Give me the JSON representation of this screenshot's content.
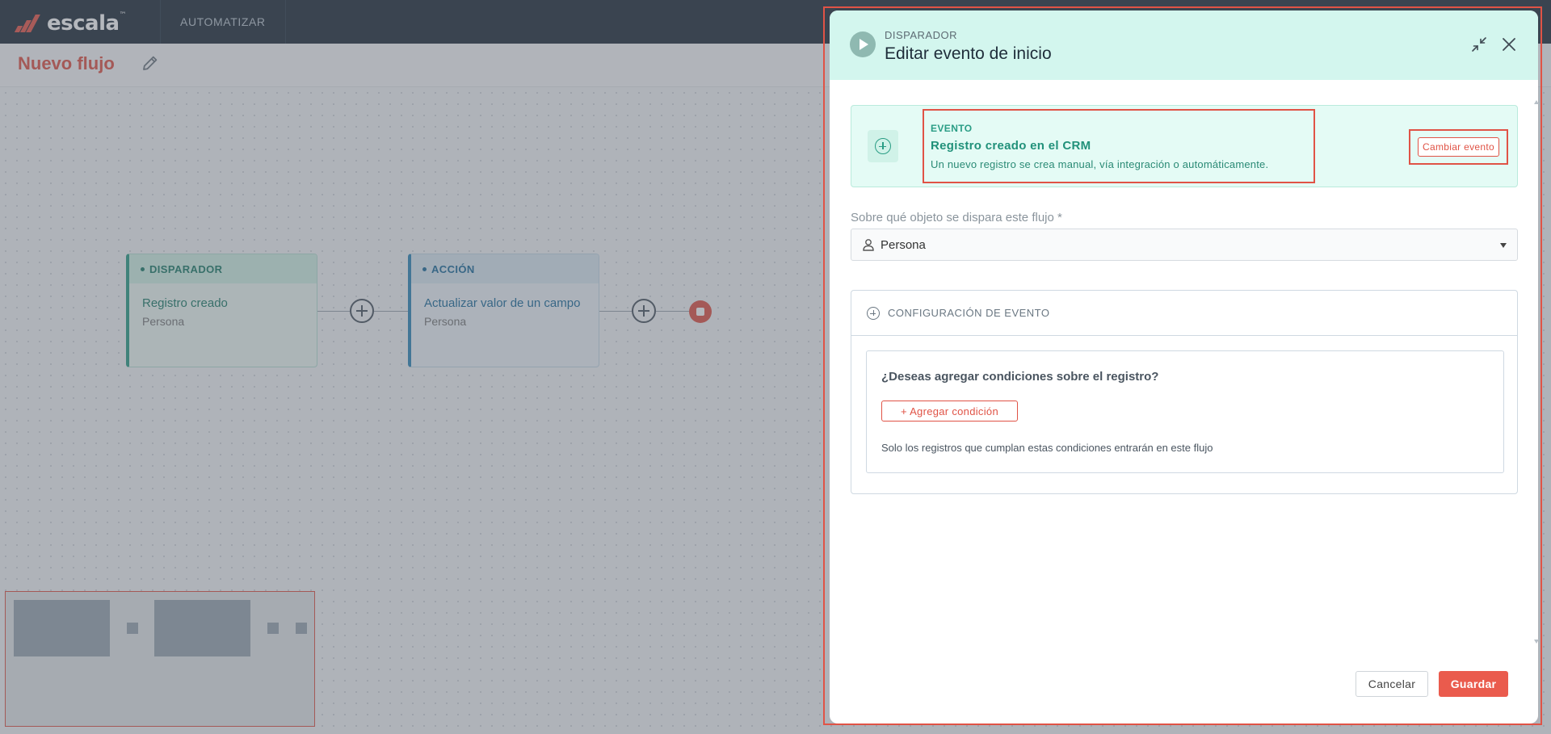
{
  "app": {
    "logo_text": "escala",
    "logo_tm": "™",
    "nav_item": "AUTOMATIZAR"
  },
  "page": {
    "title": "Nuevo flujo"
  },
  "flow": {
    "trigger_node": {
      "label": "DISPARADOR",
      "title": "Registro creado",
      "subtitle": "Persona"
    },
    "action_node": {
      "label": "ACCIÓN",
      "title": "Actualizar valor de un campo",
      "subtitle": "Persona"
    }
  },
  "modal": {
    "kicker": "DISPARADOR",
    "title": "Editar evento de inicio",
    "event": {
      "label": "EVENTO",
      "name": "Registro creado en el CRM",
      "description": "Un nuevo registro se crea manual, vía integración o automáticamente.",
      "change_button": "Cambiar evento"
    },
    "object_field": {
      "label": "Sobre qué objeto se dispara este flujo *",
      "value": "Persona"
    },
    "config": {
      "title": "CONFIGURACIÓN DE EVENTO",
      "question": "¿Deseas agregar condiciones sobre el registro?",
      "add_button": "+ Agregar condición",
      "help": "Solo los registros que cumplan estas condiciones entrarán en este flujo"
    },
    "cancel_button": "Cancelar",
    "save_button": "Guardar"
  },
  "colors": {
    "brand": "#e05346",
    "nav_bg": "#1f2d3a",
    "trigger": "#2a9d85",
    "action": "#2f87b9"
  }
}
